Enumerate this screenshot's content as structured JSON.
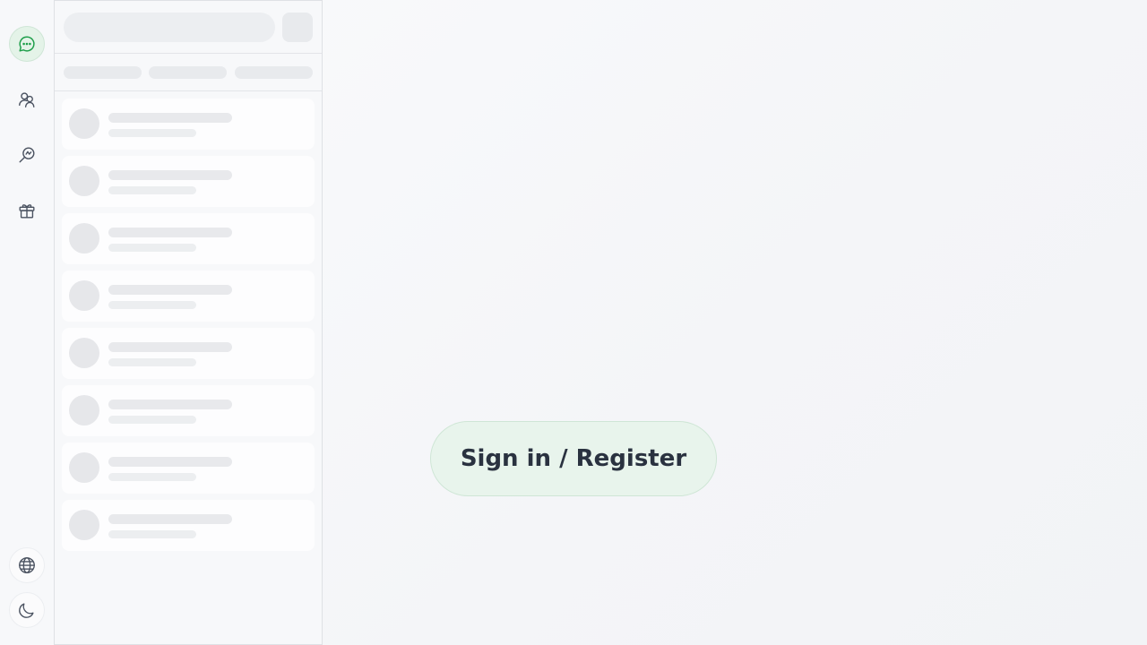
{
  "rail": {
    "top_items": [
      {
        "name": "chat-icon",
        "active": true
      },
      {
        "name": "contacts-icon",
        "active": false
      },
      {
        "name": "discover-icon",
        "active": false
      },
      {
        "name": "gift-icon",
        "active": false
      }
    ],
    "bottom_items": [
      {
        "name": "language-icon"
      },
      {
        "name": "dark-mode-icon"
      }
    ]
  },
  "colors": {
    "accent": "#1e9e4a",
    "accent_bg": "#e4f3e8",
    "text": "#2a3240",
    "skeleton": "#e8eaed"
  },
  "list": {
    "state": "loading",
    "placeholder_rows": 8
  },
  "main": {
    "signin_label": "Sign in / Register"
  }
}
